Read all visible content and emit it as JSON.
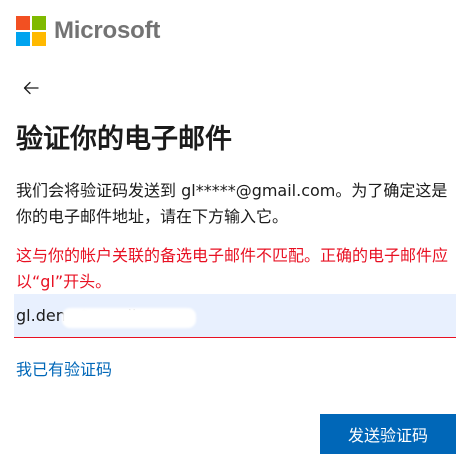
{
  "brand": {
    "name": "Microsoft",
    "logo_colors": [
      "#f25022",
      "#7fba00",
      "#00a4ef",
      "#ffb900"
    ]
  },
  "nav": {
    "back_icon": "arrow-left-icon"
  },
  "page": {
    "title": "验证你的电子邮件",
    "description": "我们会将验证码发送到 gl*****@gmail.com。为了确定这是你的电子邮件地址，请在下方输入它。",
    "error": "这与你的帐户关联的备选电子邮件不匹配。正确的电子邮件应以“gl”开头。"
  },
  "email_input": {
    "value": "gl.deng@gmail.com"
  },
  "links": {
    "have_code": "我已有验证码"
  },
  "actions": {
    "send_code": "发送验证码"
  },
  "colors": {
    "accent": "#0067b8",
    "error": "#e81123",
    "input_bg": "#e8f0fe",
    "text": "#1b1b1b",
    "logo_text": "#737373"
  }
}
